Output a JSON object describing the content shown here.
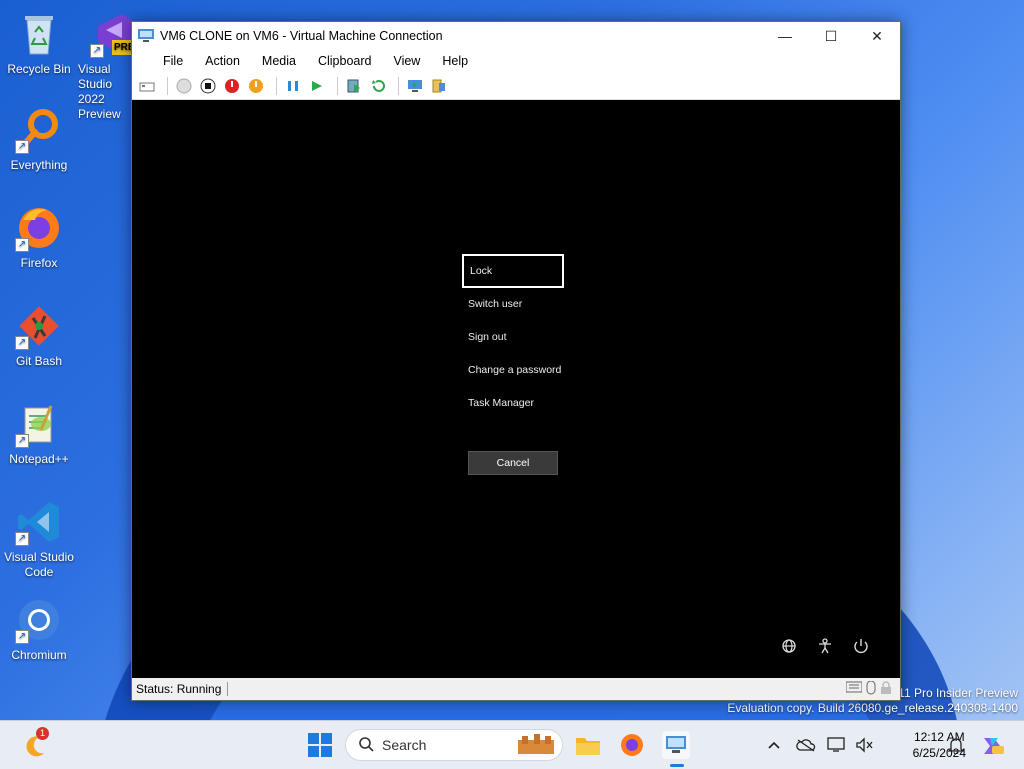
{
  "desktop": {
    "icons": [
      {
        "label": "Recycle Bin"
      },
      {
        "label": "Visual Studio 2022 Preview"
      },
      {
        "label": "Everything"
      },
      {
        "label": "Firefox"
      },
      {
        "label": "Git Bash"
      },
      {
        "label": "Notepad++"
      },
      {
        "label": "Visual Studio Code"
      },
      {
        "label": "Chromium"
      }
    ],
    "vs_badge": "PRE",
    "watermark_line1": "s 11 Pro Insider Preview",
    "watermark_line2": "Evaluation copy. Build 26080.ge_release.240308-1400"
  },
  "window": {
    "title": "VM6 CLONE on VM6 - Virtual Machine Connection",
    "menu": [
      "File",
      "Action",
      "Media",
      "Clipboard",
      "View",
      "Help"
    ],
    "toolbar_icons": [
      "ctrl-alt-del-icon",
      "start-icon",
      "turn-off-icon",
      "shut-down-icon",
      "save-icon",
      "pause-icon",
      "resume-icon",
      "checkpoint-icon",
      "revert-icon",
      "enhanced-session-icon",
      "share-icon"
    ],
    "status": "Status: Running"
  },
  "security_screen": {
    "options": [
      "Lock",
      "Switch user",
      "Sign out",
      "Change a password",
      "Task Manager"
    ],
    "selected_index": 0,
    "cancel": "Cancel"
  },
  "taskbar": {
    "search_placeholder": "Search",
    "time": "12:12 AM",
    "date": "6/25/2024",
    "notification_badge": "1"
  }
}
